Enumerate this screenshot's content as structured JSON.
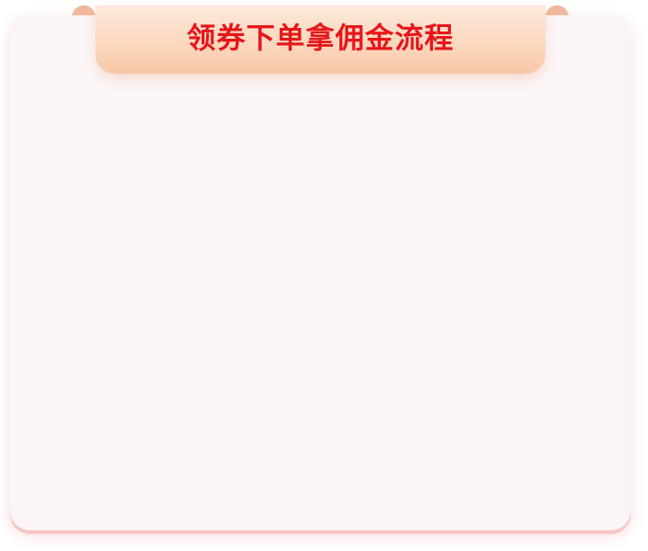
{
  "banner": {
    "title": "领券下单拿佣金流程"
  },
  "colors": {
    "title_red": "#e6161a",
    "card_bg": "#fcf5f5",
    "ribbon_light": "#fde9dc",
    "ribbon_dark": "#f8c7a6"
  }
}
